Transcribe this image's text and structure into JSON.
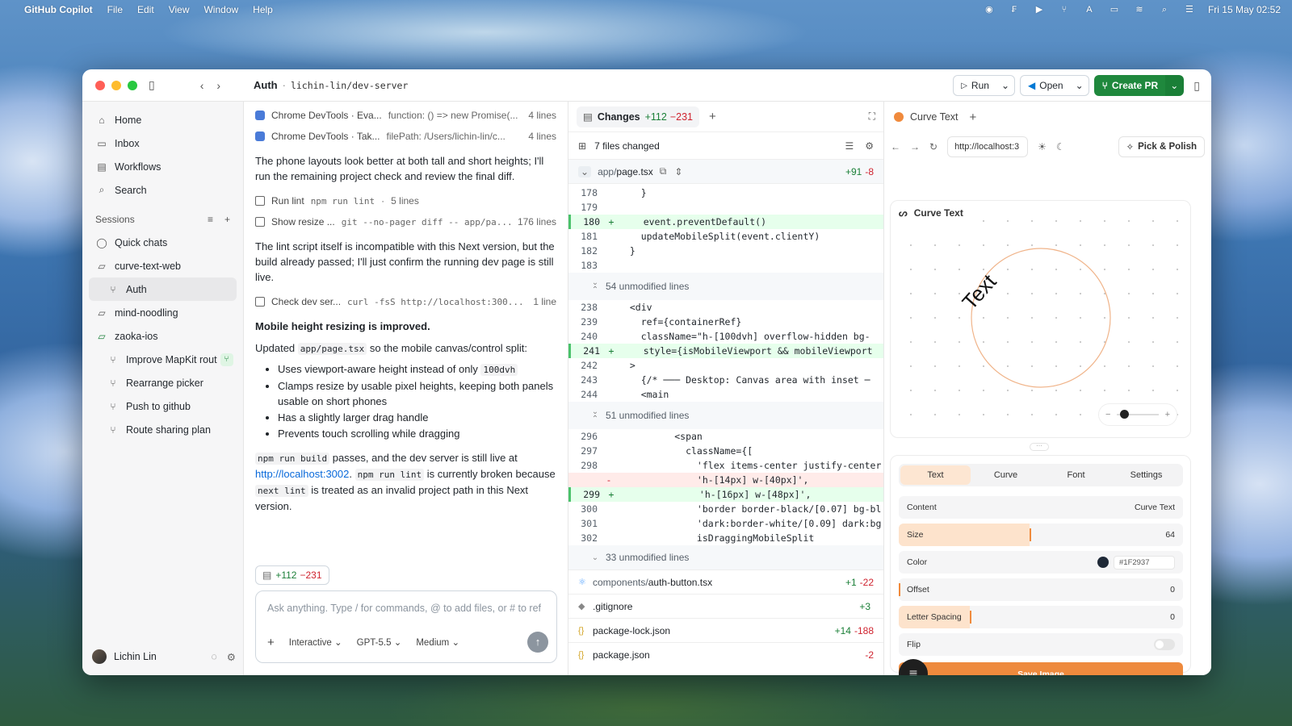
{
  "menubar": {
    "app": "GitHub Copilot",
    "menus": [
      "File",
      "Edit",
      "View",
      "Window",
      "Help"
    ],
    "clock": "Fri 15 May  02:52"
  },
  "titlebar": {
    "title": "Auth",
    "separator": "·",
    "repo": "lichin-lin/dev-server",
    "run": "Run",
    "open": "Open",
    "create_pr": "Create PR"
  },
  "sidebar": {
    "nav": [
      {
        "label": "Home",
        "icon": "home-icon"
      },
      {
        "label": "Inbox",
        "icon": "inbox-icon"
      },
      {
        "label": "Workflows",
        "icon": "workflows-icon"
      },
      {
        "label": "Search",
        "icon": "search-icon"
      }
    ],
    "sessions_label": "Sessions",
    "sessions": [
      {
        "label": "Quick chats",
        "icon": "chat-icon",
        "sub": false
      },
      {
        "label": "curve-text-web",
        "icon": "folder-icon",
        "sub": false
      },
      {
        "label": "Auth",
        "icon": "branch-icon",
        "sub": true,
        "active": true
      },
      {
        "label": "mind-noodling",
        "icon": "folder-icon",
        "sub": false
      },
      {
        "label": "zaoka-ios",
        "icon": "folder-icon",
        "sub": false
      },
      {
        "label": "Improve MapKit rout",
        "icon": "branch-icon",
        "sub": true
      },
      {
        "label": "Rearrange picker",
        "icon": "branch-icon",
        "sub": true
      },
      {
        "label": "Push to github",
        "icon": "branch-icon",
        "sub": true
      },
      {
        "label": "Route sharing plan",
        "icon": "branch-icon",
        "sub": true
      }
    ],
    "user": "Lichin Lin"
  },
  "chat": {
    "tool1": {
      "name": "Chrome DevTools · Eva...",
      "arg": "function: () => new Promise(...",
      "count": "4 lines"
    },
    "tool2": {
      "name": "Chrome DevTools · Tak...",
      "arg": "filePath: /Users/lichin-lin/c...",
      "count": "4 lines"
    },
    "p1": "The phone layouts look better at both tall and short heights; I'll run the remaining project check and review the final diff.",
    "tool3": {
      "name": "Run lint",
      "arg": "npm run lint",
      "count": "5 lines"
    },
    "tool4": {
      "name": "Show resize ...",
      "arg": "git --no-pager diff -- app/pa...",
      "count": "176 lines"
    },
    "p2": "The lint script itself is incompatible with this Next version, but the build already passed; I'll just confirm the running dev page is still live.",
    "tool5": {
      "name": "Check dev ser...",
      "arg": "curl -fsS http://localhost:300...",
      "count": "1 line"
    },
    "heading": "Mobile height resizing is improved.",
    "p3a": "Updated",
    "p3code": "app/page.tsx",
    "p3b": "so the mobile canvas/control split:",
    "bullets": [
      "Uses viewport-aware height instead of only",
      "Clamps resize by usable pixel heights, keeping both panels usable on short phones",
      "Has a slightly larger drag handle",
      "Prevents touch scrolling while dragging"
    ],
    "bullet1code": "100dvh",
    "p4code1": "npm run build",
    "p4a": "passes, and the dev server is still live at",
    "p4link": "http://localhost:3002",
    "p4code2": "npm run lint",
    "p4b": "is currently broken because",
    "p4code3": "next lint",
    "p4c": "is treated as an invalid project path in this Next version.",
    "chip_add": "+112",
    "chip_del": "−231",
    "placeholder": "Ask anything. Type / for commands, @ to add files, or # to ref",
    "mode": "Interactive",
    "model": "GPT-5.5",
    "effort": "Medium"
  },
  "changes": {
    "tab": "Changes",
    "add": "+112",
    "del": "−231",
    "files_changed": "7 files changed",
    "file1": {
      "dir": "app/",
      "name": "page.tsx",
      "add": "+91",
      "del": "-8"
    },
    "block1": [
      {
        "n": "178",
        "m": "",
        "t": "    }",
        "type": ""
      },
      {
        "n": "179",
        "m": "",
        "t": "",
        "type": ""
      },
      {
        "n": "180",
        "m": "+",
        "t": "    event.preventDefault()",
        "type": "ins"
      },
      {
        "n": "181",
        "m": "",
        "t": "    updateMobileSplit(event.clientY)",
        "type": ""
      },
      {
        "n": "182",
        "m": "",
        "t": "  }",
        "type": ""
      },
      {
        "n": "183",
        "m": "",
        "t": "",
        "type": ""
      }
    ],
    "unmod1": "54 unmodified lines",
    "block2": [
      {
        "n": "238",
        "m": "",
        "t": "  <div",
        "type": ""
      },
      {
        "n": "239",
        "m": "",
        "t": "    ref={containerRef}",
        "type": ""
      },
      {
        "n": "240",
        "m": "",
        "t": "    className=\"h-[100dvh] overflow-hidden bg-",
        "type": ""
      },
      {
        "n": "241",
        "m": "+",
        "t": "    style={isMobileViewport && mobileViewport",
        "type": "ins"
      },
      {
        "n": "242",
        "m": "",
        "t": "  >",
        "type": ""
      },
      {
        "n": "243",
        "m": "",
        "t": "    {/* ─── Desktop: Canvas area with inset ─",
        "type": ""
      },
      {
        "n": "244",
        "m": "",
        "t": "    <main",
        "type": ""
      }
    ],
    "unmod2": "51 unmodified lines",
    "block3": [
      {
        "n": "296",
        "m": "",
        "t": "          <span",
        "type": ""
      },
      {
        "n": "297",
        "m": "",
        "t": "            className={[",
        "type": ""
      },
      {
        "n": "298",
        "m": "",
        "t": "              'flex items-center justify-center",
        "type": ""
      },
      {
        "n": "",
        "m": "-",
        "t": "              'h-[14px] w-[40px]',",
        "type": "rem"
      },
      {
        "n": "299",
        "m": "+",
        "t": "              'h-[16px] w-[48px]',",
        "type": "ins"
      },
      {
        "n": "300",
        "m": "",
        "t": "              'border border-black/[0.07] bg-bl",
        "type": ""
      },
      {
        "n": "301",
        "m": "",
        "t": "              'dark:border-white/[0.09] dark:bg",
        "type": ""
      },
      {
        "n": "302",
        "m": "",
        "t": "              isDraggingMobileSplit",
        "type": ""
      }
    ],
    "unmod3": "33 unmodified lines",
    "files": [
      {
        "dir": "components/",
        "name": "auth-button.tsx",
        "add": "+1",
        "del": "-22",
        "icon": "react-icon"
      },
      {
        "dir": "",
        "name": ".gitignore",
        "add": "+3",
        "del": "",
        "icon": "git-icon"
      },
      {
        "dir": "",
        "name": "package-lock.json",
        "add": "+14",
        "del": "-188",
        "icon": "json-icon"
      },
      {
        "dir": "",
        "name": "package.json",
        "add": "",
        "del": "-2",
        "icon": "json-icon"
      }
    ]
  },
  "preview": {
    "tab": "Curve Text",
    "url": "http://localhost:3",
    "pick": "Pick & Polish",
    "canvas_label": "Curve Text",
    "curve_word": "Text",
    "segments": [
      "Text",
      "Curve",
      "Font",
      "Settings"
    ],
    "rows": {
      "content_label": "Content",
      "content_value": "Curve Text",
      "size_label": "Size",
      "size_value": "64",
      "size_fraction": 0.46,
      "color_label": "Color",
      "color_value": "#1F2937",
      "offset_label": "Offset",
      "offset_value": "0",
      "spacing_label": "Letter Spacing",
      "spacing_value": "0",
      "flip_label": "Flip"
    },
    "save": "Save Image",
    "accent": "#EE8A3D"
  }
}
